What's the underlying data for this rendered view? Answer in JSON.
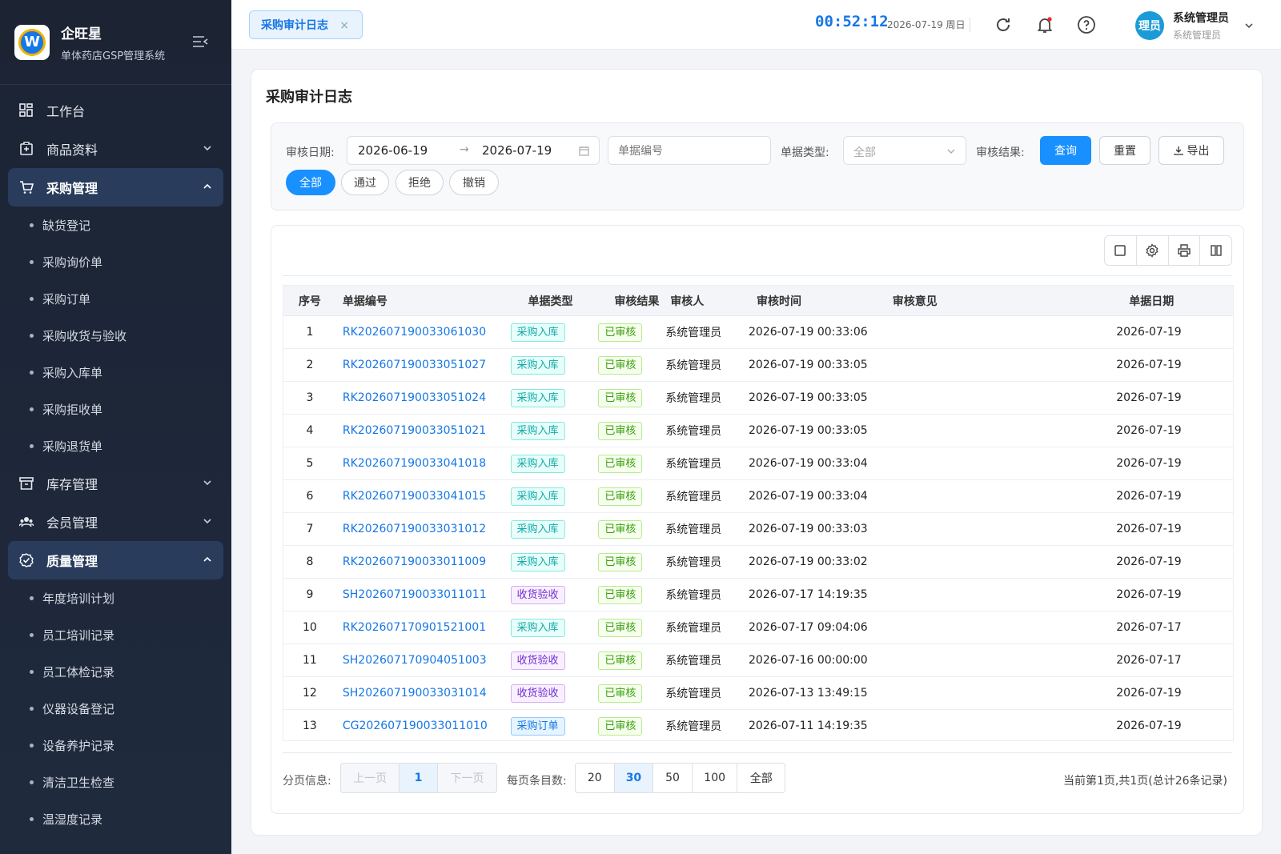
{
  "brand": {
    "name": "企旺星",
    "subtitle": "单体药店GSP管理系统",
    "logo_letter": "W"
  },
  "menu": {
    "workbench": "工作台",
    "goods": "商品资料",
    "purchase": {
      "label": "采购管理",
      "items": [
        "缺货登记",
        "采购询价单",
        "采购订单",
        "采购收货与验收",
        "采购入库单",
        "采购拒收单",
        "采购退货单"
      ]
    },
    "inventory": "库存管理",
    "member": "会员管理",
    "quality": {
      "label": "质量管理",
      "items": [
        "年度培训计划",
        "员工培训记录",
        "员工体检记录",
        "仪器设备登记",
        "设备养护记录",
        "清洁卫生检查",
        "温湿度记录"
      ]
    }
  },
  "topbar": {
    "tab_label": "采购审计日志",
    "tab_close": "×",
    "clock": "00:52:12",
    "date": "2026-07-19 周日",
    "user_name": "系统管理员",
    "user_role": "系统管理员",
    "avatar_text": "理员"
  },
  "page": {
    "title": "采购审计日志"
  },
  "filter": {
    "date_label": "审核日期:",
    "date_start": "2026-06-19",
    "date_arrow": "→",
    "date_end": "2026-07-19",
    "doc_no_placeholder": "单据编号",
    "doc_type_label": "单据类型:",
    "doc_type_value": "全部",
    "result_label": "审核结果:",
    "query_btn": "查询",
    "reset_btn": "重置",
    "export_btn": "导出",
    "result_pills": [
      "全部",
      "通过",
      "拒绝",
      "撤销"
    ]
  },
  "table": {
    "headers": [
      "序号",
      "单据编号",
      "单据类型",
      "审核结果",
      "审核人",
      "审核时间",
      "审核意见",
      "单据日期"
    ],
    "rows": [
      {
        "no": "1",
        "doc": "RK202607190033061030",
        "type": "采购入库",
        "result": "已审核",
        "auditor": "系统管理员",
        "time": "2026-07-19 00:33:06",
        "opinion": "",
        "date": "2026-07-19"
      },
      {
        "no": "2",
        "doc": "RK202607190033051027",
        "type": "采购入库",
        "result": "已审核",
        "auditor": "系统管理员",
        "time": "2026-07-19 00:33:05",
        "opinion": "",
        "date": "2026-07-19"
      },
      {
        "no": "3",
        "doc": "RK202607190033051024",
        "type": "采购入库",
        "result": "已审核",
        "auditor": "系统管理员",
        "time": "2026-07-19 00:33:05",
        "opinion": "",
        "date": "2026-07-19"
      },
      {
        "no": "4",
        "doc": "RK202607190033051021",
        "type": "采购入库",
        "result": "已审核",
        "auditor": "系统管理员",
        "time": "2026-07-19 00:33:05",
        "opinion": "",
        "date": "2026-07-19"
      },
      {
        "no": "5",
        "doc": "RK202607190033041018",
        "type": "采购入库",
        "result": "已审核",
        "auditor": "系统管理员",
        "time": "2026-07-19 00:33:04",
        "opinion": "",
        "date": "2026-07-19"
      },
      {
        "no": "6",
        "doc": "RK202607190033041015",
        "type": "采购入库",
        "result": "已审核",
        "auditor": "系统管理员",
        "time": "2026-07-19 00:33:04",
        "opinion": "",
        "date": "2026-07-19"
      },
      {
        "no": "7",
        "doc": "RK202607190033031012",
        "type": "采购入库",
        "result": "已审核",
        "auditor": "系统管理员",
        "time": "2026-07-19 00:33:03",
        "opinion": "",
        "date": "2026-07-19"
      },
      {
        "no": "8",
        "doc": "RK202607190033011009",
        "type": "采购入库",
        "result": "已审核",
        "auditor": "系统管理员",
        "time": "2026-07-19 00:33:02",
        "opinion": "",
        "date": "2026-07-19"
      },
      {
        "no": "9",
        "doc": "SH202607190033011011",
        "type": "收货验收",
        "result": "已审核",
        "auditor": "系统管理员",
        "time": "2026-07-17 14:19:35",
        "opinion": "",
        "date": "2026-07-19"
      },
      {
        "no": "10",
        "doc": "RK202607170901521001",
        "type": "采购入库",
        "result": "已审核",
        "auditor": "系统管理员",
        "time": "2026-07-17 09:04:06",
        "opinion": "",
        "date": "2026-07-17"
      },
      {
        "no": "11",
        "doc": "SH202607170904051003",
        "type": "收货验收",
        "result": "已审核",
        "auditor": "系统管理员",
        "time": "2026-07-16 00:00:00",
        "opinion": "",
        "date": "2026-07-17"
      },
      {
        "no": "12",
        "doc": "SH202607190033031014",
        "type": "收货验收",
        "result": "已审核",
        "auditor": "系统管理员",
        "time": "2026-07-13 13:49:15",
        "opinion": "",
        "date": "2026-07-19"
      },
      {
        "no": "13",
        "doc": "CG202607190033011010",
        "type": "采购订单",
        "result": "已审核",
        "auditor": "系统管理员",
        "time": "2026-07-11 14:19:35",
        "opinion": "",
        "date": "2026-07-19"
      }
    ]
  },
  "pager": {
    "label": "分页信息:",
    "prev": "上一页",
    "current": "1",
    "next": "下一页",
    "size_label": "每页条目数:",
    "sizes": [
      "20",
      "30",
      "50",
      "100",
      "全部"
    ],
    "selected_size": "30",
    "summary": "当前第1页,共1页(总计26条记录)"
  },
  "colors": {
    "accent": "#1890ff",
    "sidebar": "#1c2434",
    "active_menu": "#2a3c5c"
  }
}
